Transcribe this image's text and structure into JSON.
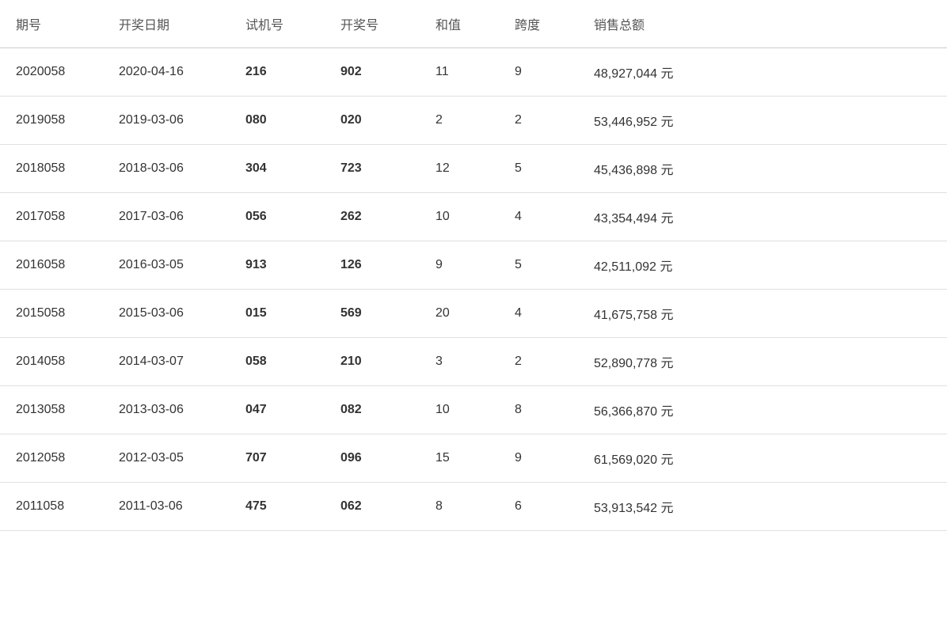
{
  "table": {
    "headers": [
      "期号",
      "开奖日期",
      "试机号",
      "开奖号",
      "和值",
      "跨度",
      "销售总额"
    ],
    "rows": [
      {
        "qihao": "2020058",
        "date": "2020-04-16",
        "shiji": "216",
        "kaijang": "902",
        "hezhi": "11",
        "kuadu": "9",
        "sales": "48,927,044 元"
      },
      {
        "qihao": "2019058",
        "date": "2019-03-06",
        "shiji": "080",
        "kaijang": "020",
        "hezhi": "2",
        "kuadu": "2",
        "sales": "53,446,952 元"
      },
      {
        "qihao": "2018058",
        "date": "2018-03-06",
        "shiji": "304",
        "kaijang": "723",
        "hezhi": "12",
        "kuadu": "5",
        "sales": "45,436,898 元"
      },
      {
        "qihao": "2017058",
        "date": "2017-03-06",
        "shiji": "056",
        "kaijang": "262",
        "hezhi": "10",
        "kuadu": "4",
        "sales": "43,354,494 元"
      },
      {
        "qihao": "2016058",
        "date": "2016-03-05",
        "shiji": "913",
        "kaijang": "126",
        "hezhi": "9",
        "kuadu": "5",
        "sales": "42,511,092 元"
      },
      {
        "qihao": "2015058",
        "date": "2015-03-06",
        "shiji": "015",
        "kaijang": "569",
        "hezhi": "20",
        "kuadu": "4",
        "sales": "41,675,758 元"
      },
      {
        "qihao": "2014058",
        "date": "2014-03-07",
        "shiji": "058",
        "kaijang": "210",
        "hezhi": "3",
        "kuadu": "2",
        "sales": "52,890,778 元"
      },
      {
        "qihao": "2013058",
        "date": "2013-03-06",
        "shiji": "047",
        "kaijang": "082",
        "hezhi": "10",
        "kuadu": "8",
        "sales": "56,366,870 元"
      },
      {
        "qihao": "2012058",
        "date": "2012-03-05",
        "shiji": "707",
        "kaijang": "096",
        "hezhi": "15",
        "kuadu": "9",
        "sales": "61,569,020 元"
      },
      {
        "qihao": "2011058",
        "date": "2011-03-06",
        "shiji": "475",
        "kaijang": "062",
        "hezhi": "8",
        "kuadu": "6",
        "sales": "53,913,542 元"
      }
    ]
  }
}
